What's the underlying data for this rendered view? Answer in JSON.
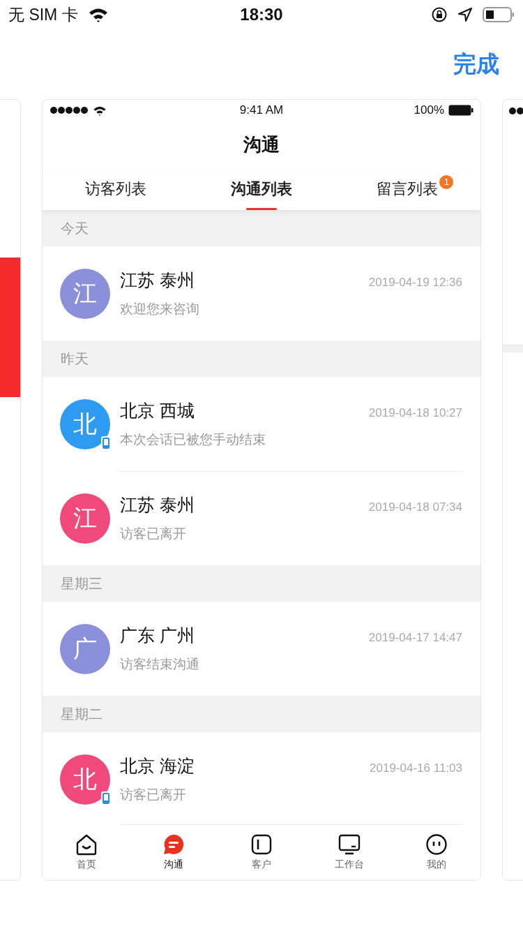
{
  "status_bar": {
    "carrier": "无 SIM 卡",
    "time": "18:30"
  },
  "nav": {
    "done": "完成"
  },
  "phone": {
    "status_bar": {
      "time": "9:41 AM",
      "battery": "100%"
    },
    "title": "沟通",
    "tabs": [
      {
        "label": "访客列表",
        "selected": false
      },
      {
        "label": "沟通列表",
        "selected": true
      },
      {
        "label": "留言列表",
        "selected": false,
        "badge": "1"
      }
    ],
    "sections": [
      {
        "header": "今天",
        "items": [
          {
            "avatar": "江",
            "color": "#8a90da",
            "name": "江苏 泰州",
            "time": "2019-04-19 12:36",
            "message": "欢迎您来咨询",
            "mobile": false
          }
        ]
      },
      {
        "header": "昨天",
        "items": [
          {
            "avatar": "北",
            "color": "#2d9cf0",
            "name": "北京 西城",
            "time": "2019-04-18 10:27",
            "message": "本次会话已被您手动结束",
            "mobile": true
          },
          {
            "avatar": "江",
            "color": "#f04a7c",
            "name": "江苏 泰州",
            "time": "2019-04-18 07:34",
            "message": "访客已离开",
            "mobile": false
          }
        ]
      },
      {
        "header": "星期三",
        "items": [
          {
            "avatar": "广",
            "color": "#8a90da",
            "name": "广东 广州",
            "time": "2019-04-17 14:47",
            "message": "访客结束沟通",
            "mobile": false
          }
        ]
      },
      {
        "header": "星期二",
        "items": [
          {
            "avatar": "北",
            "color": "#f04a7c",
            "name": "北京 海淀",
            "time": "2019-04-16 11:03",
            "message": "访客已离开",
            "mobile": true
          }
        ]
      }
    ],
    "tab_bar": [
      {
        "label": "首页",
        "kind": "home",
        "selected": false
      },
      {
        "label": "沟通",
        "kind": "chat",
        "selected": true
      },
      {
        "label": "客户",
        "kind": "customer",
        "selected": false
      },
      {
        "label": "工作台",
        "kind": "desk",
        "selected": false
      },
      {
        "label": "我的",
        "kind": "me",
        "selected": false
      }
    ]
  }
}
